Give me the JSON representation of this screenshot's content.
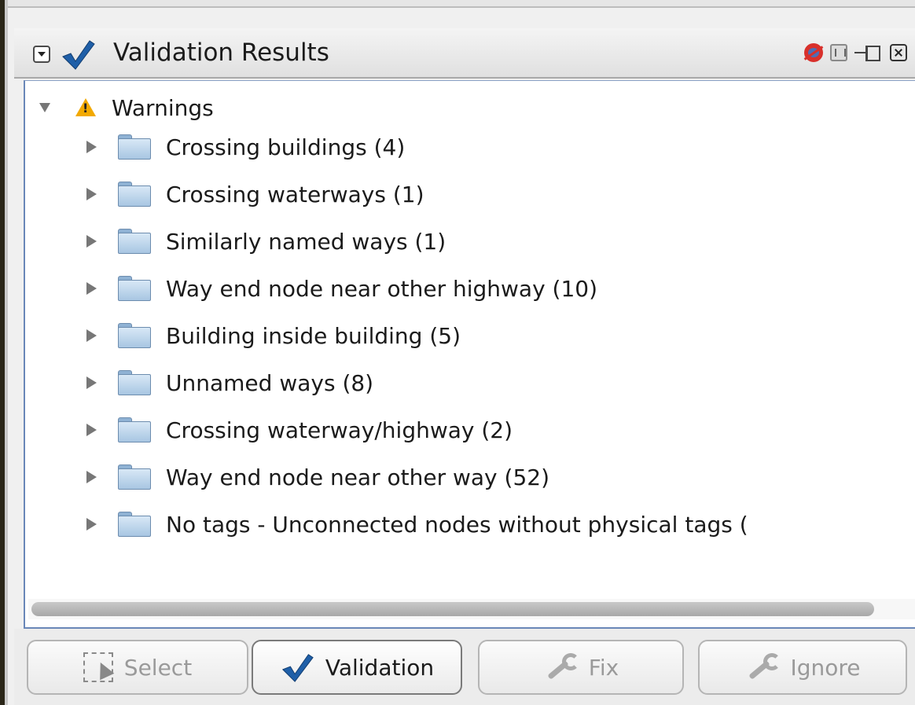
{
  "panel": {
    "title": "Validation Results"
  },
  "tree": {
    "root": {
      "label": "Warnings",
      "icon": "warning-icon",
      "expanded": true
    },
    "items": [
      {
        "label": "Crossing buildings (4)"
      },
      {
        "label": "Crossing waterways (1)"
      },
      {
        "label": "Similarly named ways (1)"
      },
      {
        "label": "Way end node near other highway (10)"
      },
      {
        "label": "Building inside building (5)"
      },
      {
        "label": "Unnamed ways (8)"
      },
      {
        "label": "Crossing waterway/highway (2)"
      },
      {
        "label": "Way end node near other way (52)"
      },
      {
        "label": "No tags - Unconnected nodes without physical tags ("
      }
    ]
  },
  "buttons": {
    "select": "Select",
    "validation": "Validation",
    "fix": "Fix",
    "ignore": "Ignore"
  },
  "colors": {
    "accent": "#1f5fa8",
    "warning": "#f2a900",
    "folder": "#a8c6e2"
  }
}
